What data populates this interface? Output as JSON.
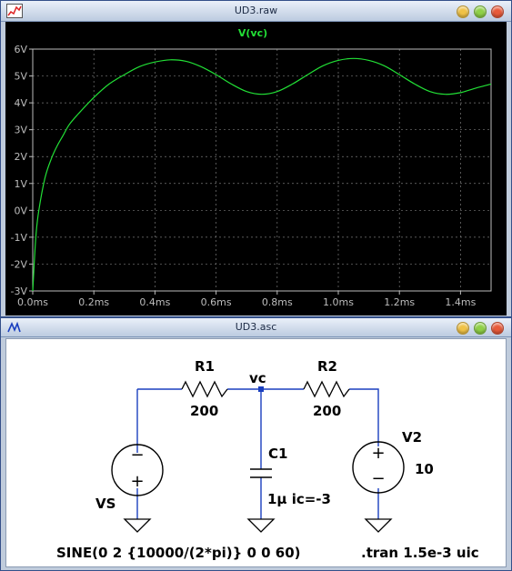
{
  "waveform_window": {
    "title": "UD3.raw",
    "trace_label": "V(vc)",
    "trace_color": "#22e036",
    "y_ticks": [
      "6V",
      "5V",
      "4V",
      "3V",
      "2V",
      "1V",
      "0V",
      "-1V",
      "-2V",
      "-3V"
    ],
    "x_ticks": [
      "0.0ms",
      "0.2ms",
      "0.4ms",
      "0.6ms",
      "0.8ms",
      "1.0ms",
      "1.2ms",
      "1.4ms"
    ]
  },
  "chart_data": {
    "type": "line",
    "title": "V(vc)",
    "xlabel": "",
    "ylabel": "",
    "xlim": [
      0,
      1.5
    ],
    "ylim": [
      -3,
      6
    ],
    "x_unit": "ms",
    "y_unit": "V",
    "grid": true,
    "series": [
      {
        "name": "V(vc)",
        "color": "#22e036",
        "x": [
          0,
          0.01,
          0.02,
          0.04,
          0.06,
          0.08,
          0.1,
          0.12,
          0.15,
          0.2,
          0.25,
          0.3,
          0.35,
          0.4,
          0.45,
          0.5,
          0.55,
          0.6,
          0.65,
          0.7,
          0.75,
          0.8,
          0.85,
          0.9,
          0.95,
          1.0,
          1.05,
          1.1,
          1.15,
          1.2,
          1.25,
          1.3,
          1.35,
          1.4,
          1.45,
          1.5
        ],
        "y": [
          -3,
          -1.0,
          0.0,
          1.2,
          1.9,
          2.4,
          2.8,
          3.2,
          3.6,
          4.2,
          4.7,
          5.05,
          5.35,
          5.52,
          5.6,
          5.55,
          5.35,
          5.05,
          4.7,
          4.42,
          4.32,
          4.42,
          4.7,
          5.05,
          5.38,
          5.58,
          5.65,
          5.58,
          5.38,
          5.05,
          4.7,
          4.42,
          4.32,
          4.38,
          4.55,
          4.7
        ]
      }
    ]
  },
  "schematic_window": {
    "title": "UD3.asc",
    "wire_color": "#1a3fbf",
    "r1": {
      "name": "R1",
      "value": "200"
    },
    "r2": {
      "name": "R2",
      "value": "200"
    },
    "node": "vc",
    "c1": {
      "name": "C1",
      "value": "1μ ic=-3"
    },
    "vs": {
      "name": "VS",
      "spec": "SINE(0 2 {10000/(2*pi)} 0 0 60)"
    },
    "v2": {
      "name": "V2",
      "value": "10"
    },
    "directive": ".tran 1.5e-3 uic",
    "minus_sign": "−",
    "plus_sign": "+"
  },
  "title_buttons": {
    "minimize": "#f0c246",
    "maximize": "#8fd047",
    "close": "#e85a3a"
  }
}
